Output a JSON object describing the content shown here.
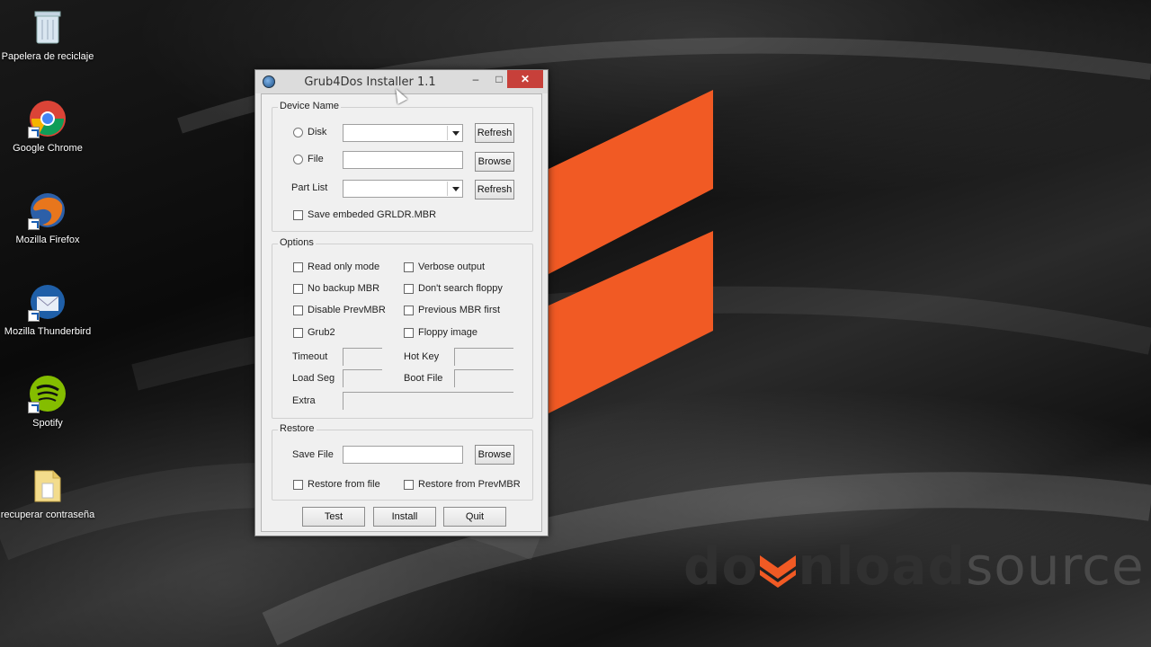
{
  "desktop": {
    "icons": [
      {
        "label": "Papelera de reciclaje",
        "icon": "recycle-bin-icon"
      },
      {
        "label": "Google Chrome",
        "icon": "chrome-icon"
      },
      {
        "label": "Mozilla Firefox",
        "icon": "firefox-icon"
      },
      {
        "label": "Mozilla Thunderbird",
        "icon": "thunderbird-icon"
      },
      {
        "label": "Spotify",
        "icon": "spotify-icon"
      },
      {
        "label": "recuperar contraseña",
        "icon": "folder-icon"
      }
    ],
    "logo": {
      "part1": "do",
      "part2": "nload",
      "part3": "source",
      "accent_color": "#f15a24"
    }
  },
  "window": {
    "title": "Grub4Dos Installer 1.1",
    "minimize": "–",
    "maximize": "□",
    "close": "✕",
    "device_group": {
      "label": "Device Name",
      "disk_label": "Disk",
      "file_label": "File",
      "partlist_label": "Part List",
      "refresh_label": "Refresh",
      "browse_label": "Browse",
      "save_embeded_label": "Save embeded GRLDR.MBR"
    },
    "options_group": {
      "label": "Options",
      "read_only": "Read only mode",
      "verbose": "Verbose output",
      "no_backup": "No backup MBR",
      "dont_search": "Don't search floppy",
      "disable_prev": "Disable PrevMBR",
      "previous_first": "Previous MBR first",
      "grub2": "Grub2",
      "floppy_image": "Floppy image",
      "timeout": "Timeout",
      "hot_key": "Hot Key",
      "load_seg": "Load Seg",
      "boot_file": "Boot File",
      "extra": "Extra"
    },
    "restore_group": {
      "label": "Restore",
      "save_file": "Save File",
      "browse_label": "Browse",
      "restore_from_file": "Restore from file",
      "restore_from_prev": "Restore from PrevMBR"
    },
    "footer": {
      "test": "Test",
      "install": "Install",
      "quit": "Quit"
    }
  }
}
